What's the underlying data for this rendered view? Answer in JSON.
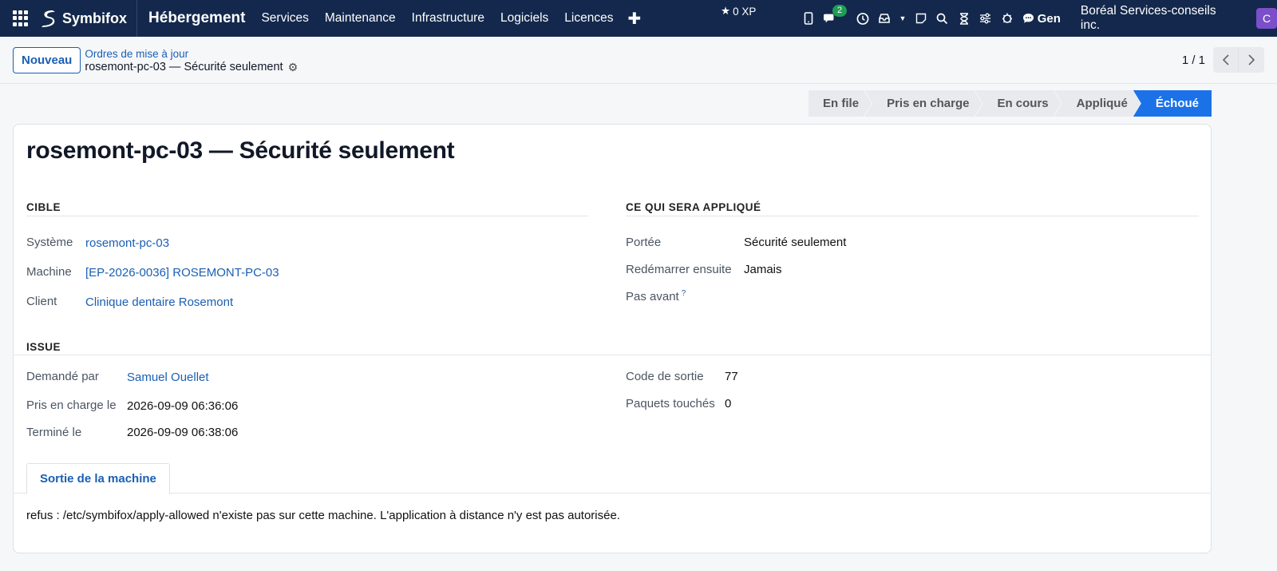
{
  "nav": {
    "brand": "Symbifox",
    "app_name": "Hébergement",
    "menu": [
      "Services",
      "Maintenance",
      "Infrastructure",
      "Logiciels",
      "Licences"
    ],
    "xp": "0 XP",
    "messages_count": "2",
    "gen_label": "Gen",
    "company": "Boréal Services-conseils inc.",
    "avatar_letter": "C"
  },
  "control": {
    "new_button": "Nouveau",
    "breadcrumb_parent": "Ordres de mise à jour",
    "breadcrumb_current": "rosemont-pc-03 — Sécurité seulement",
    "pager": "1 / 1"
  },
  "status_stages": [
    "En file",
    "Pris en charge",
    "En cours",
    "Appliqué",
    "Échoué"
  ],
  "active_stage": "Échoué",
  "record": {
    "title": "rosemont-pc-03 — Sécurité seulement",
    "section_target": "CIBLE",
    "section_applied": "CE QUI SERA APPLIQUÉ",
    "section_outcome": "ISSUE",
    "target": {
      "system_label": "Système",
      "system_value": "rosemont-pc-03",
      "machine_label": "Machine",
      "machine_value": "[EP-2026-0036] ROSEMONT-PC-03",
      "client_label": "Client",
      "client_value": "Clinique dentaire Rosemont"
    },
    "applied": {
      "scope_label": "Portée",
      "scope_value": "Sécurité seulement",
      "reboot_label": "Redémarrer ensuite",
      "reboot_value": "Jamais",
      "not_before_label": "Pas avant",
      "not_before_help": "?"
    },
    "outcome": {
      "requested_label": "Demandé par",
      "requested_value": "Samuel Ouellet",
      "taken_label": "Pris en charge le",
      "taken_value": "2026-09-09 06:36:06",
      "done_label": "Terminé le",
      "done_value": "2026-09-09 06:38:06",
      "exit_label": "Code de sortie",
      "exit_value": "77",
      "packages_label": "Paquets touchés",
      "packages_value": "0"
    },
    "tab_label": "Sortie de la machine",
    "machine_output": "refus : /etc/symbifox/apply-allowed n'existe pas sur cette machine. L'application à distance n'y est pas autorisée."
  }
}
